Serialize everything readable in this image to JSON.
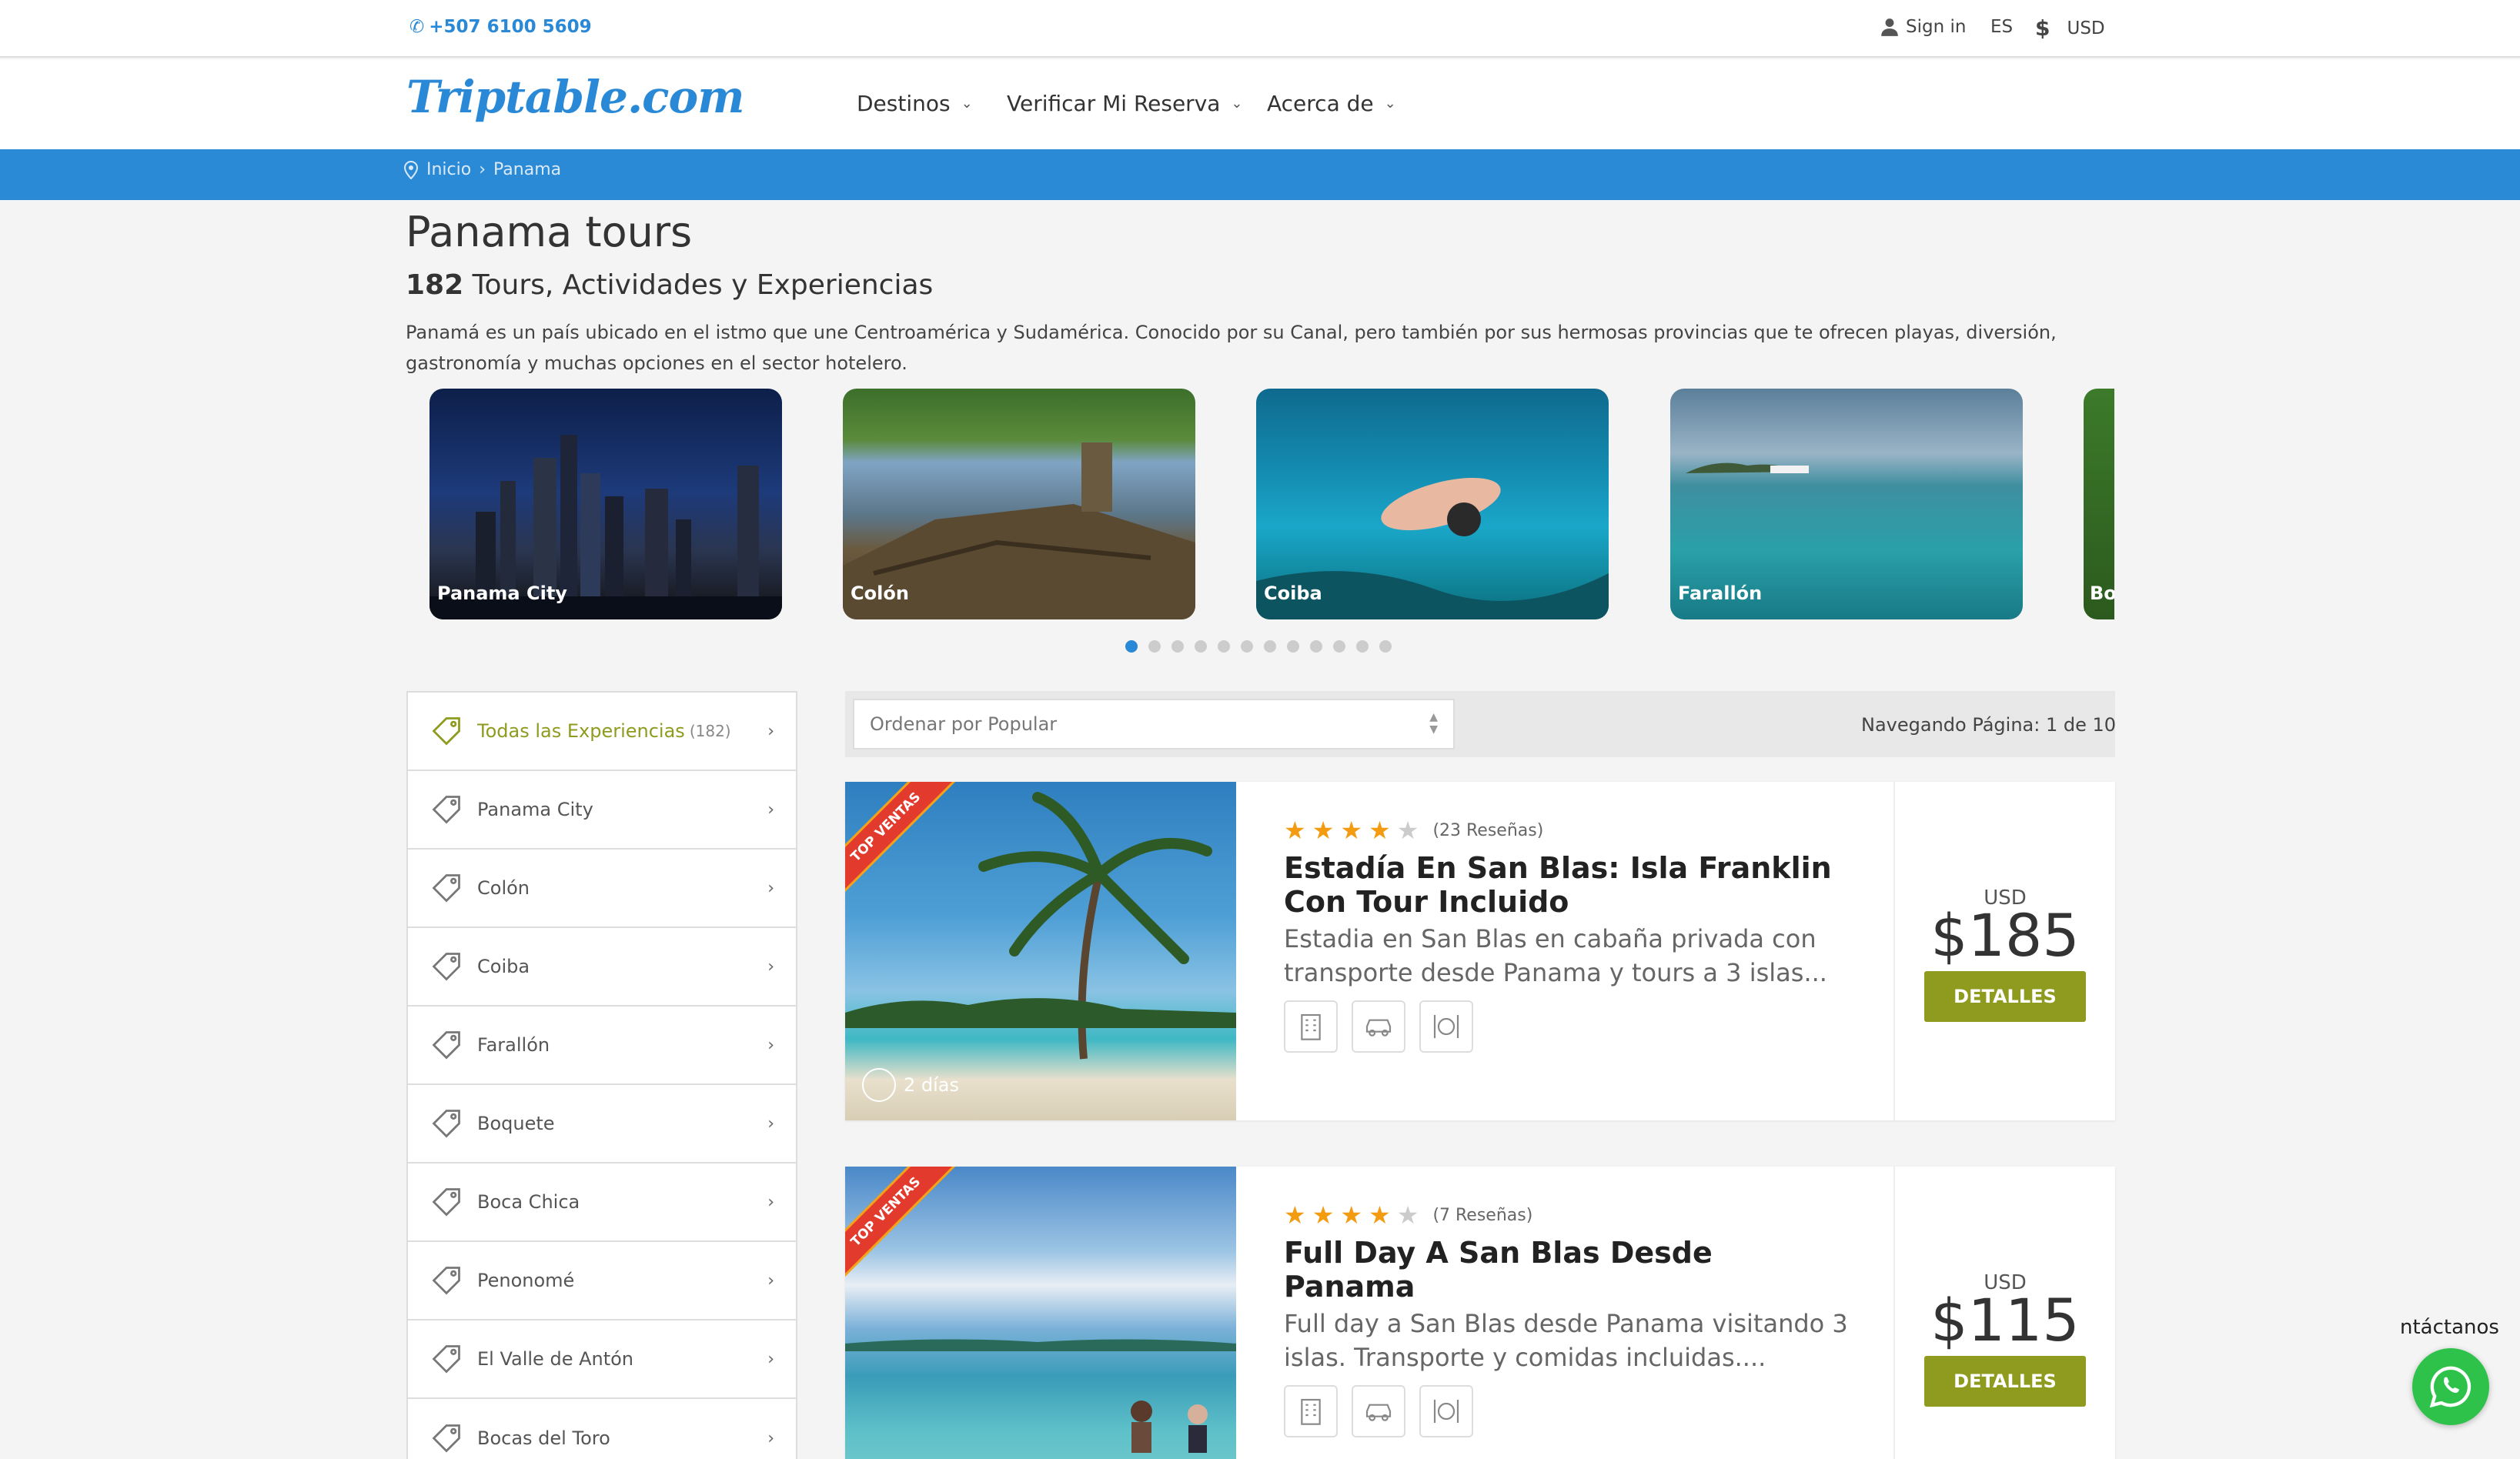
{
  "topbar": {
    "phone": "+507 6100 5609",
    "signin": "Sign in",
    "lang": "ES",
    "currency": "USD"
  },
  "header": {
    "logo": "Triptable.com",
    "nav": [
      "Destinos",
      "Verificar Mi Reserva",
      "Acerca de"
    ]
  },
  "breadcrumb": {
    "home": "Inicio",
    "sep": "›",
    "current": "Panama"
  },
  "page": {
    "title": "Panama tours",
    "count": "182",
    "subtitle": "Tours, Actividades y Experiencias",
    "description": "Panamá es un país ubicado en el istmo que une Centroamérica y Sudamérica. Conocido por su Canal, pero también por sus hermosas provincias que te ofrecen playas, diversión, gastronomía y muchas opciones en el sector hotelero."
  },
  "carousel": {
    "cards": [
      "Panama City",
      "Colón",
      "Coiba",
      "Farallón",
      "Bo"
    ]
  },
  "sidebar": {
    "items": [
      {
        "label": "Todas las Experiencias",
        "count": "(182)"
      },
      {
        "label": "Panama City"
      },
      {
        "label": "Colón"
      },
      {
        "label": "Coiba"
      },
      {
        "label": "Farallón"
      },
      {
        "label": "Boquete"
      },
      {
        "label": "Boca Chica"
      },
      {
        "label": "Penonomé"
      },
      {
        "label": "El Valle de Antón"
      },
      {
        "label": "Bocas del Toro"
      }
    ]
  },
  "sort": {
    "value": "Ordenar por Popular",
    "pager": "Navegando Página: 1 de 10"
  },
  "tours": [
    {
      "ribbon": "TOP VENTAS",
      "duration": "2 días",
      "rating": 4,
      "reviews": "(23 Reseñas)",
      "title": "Estadía En San Blas: Isla Franklin Con Tour Incluido",
      "description": "Estadia en San Blas en cabaña privada con transporte desde Panama y tours a 3 islas...",
      "currency": "USD",
      "price": "$185",
      "button": "DETALLES"
    },
    {
      "ribbon": "TOP VENTAS",
      "duration": "",
      "rating": 4,
      "reviews": "(7 Reseñas)",
      "title": "Full Day A San Blas Desde Panama",
      "description": "Full day a San Blas desde Panama visitando 3 islas. Transporte y comidas incluidas....",
      "currency": "USD",
      "price": "$115",
      "button": "DETALLES"
    }
  ],
  "contact": {
    "label": "ntáctanos"
  },
  "colors": {
    "primary": "#2b8ad6",
    "accent": "#8f9b1e",
    "ribbon": "#e33a2e"
  }
}
